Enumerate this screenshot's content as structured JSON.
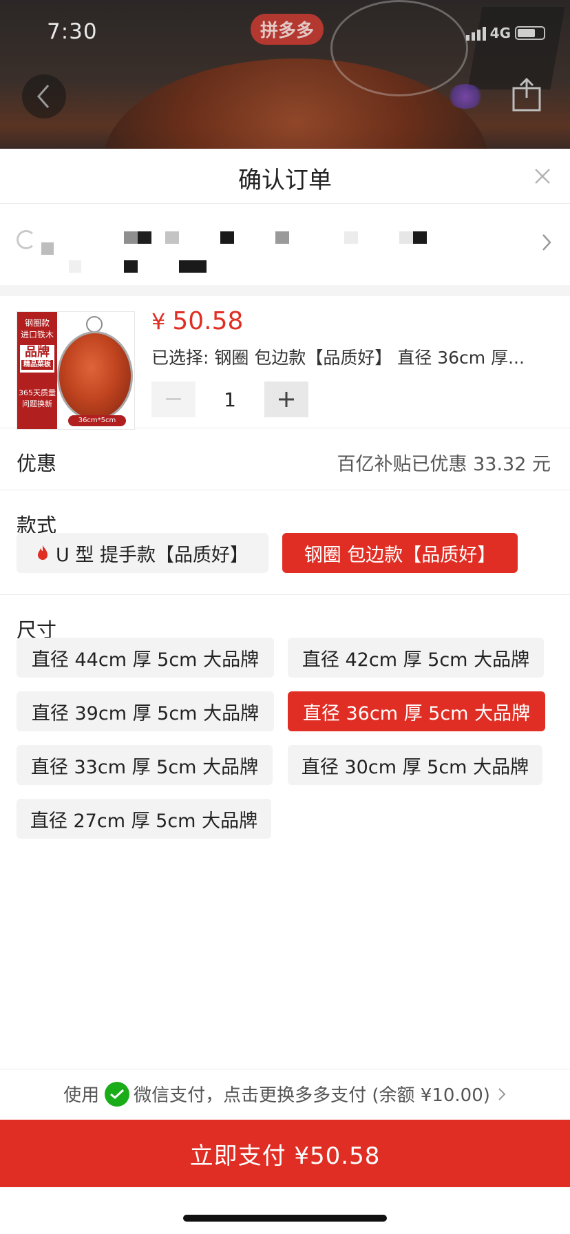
{
  "status_bar": {
    "time": "7:30",
    "network": "4G"
  },
  "backdrop": {
    "badge": "拼多多"
  },
  "sheet": {
    "title": "确认订单"
  },
  "product": {
    "currency": "¥",
    "price": "50.58",
    "selected_text": "已选择: 钢圈 包边款【品质好】 直径 36cm 厚...",
    "quantity": "1",
    "thumbnail": {
      "top_text": "钢圈款\n进口铁木",
      "brand": "品牌",
      "brand_sub": "精品菜板",
      "bottom_text": "365天质量\n问题换新",
      "dimension": "36cm*5cm"
    }
  },
  "discount": {
    "label": "优惠",
    "value": "百亿补贴已优惠 33.32 元"
  },
  "style": {
    "title": "款式",
    "options": [
      {
        "label": "U 型 提手款【品质好】",
        "active": false,
        "hot": true
      },
      {
        "label": "钢圈 包边款【品质好】",
        "active": true,
        "hot": false
      }
    ]
  },
  "size": {
    "title": "尺寸",
    "options": [
      {
        "label": "直径 44cm 厚 5cm 大品牌",
        "active": false
      },
      {
        "label": "直径 42cm 厚 5cm 大品牌",
        "active": false
      },
      {
        "label": "直径 39cm 厚 5cm 大品牌",
        "active": false
      },
      {
        "label": "直径 36cm 厚 5cm 大品牌",
        "active": true
      },
      {
        "label": "直径 33cm 厚 5cm 大品牌",
        "active": false
      },
      {
        "label": "直径 30cm 厚 5cm 大品牌",
        "active": false
      },
      {
        "label": "直径 27cm 厚 5cm 大品牌",
        "active": false
      }
    ]
  },
  "payment": {
    "prefix": "使用",
    "method_text": "微信支付，点击更换多多支付 (余额 ¥10.00)",
    "button_label": "立即支付 ¥50.58"
  },
  "colors": {
    "accent": "#e02e24",
    "wechat": "#1aad19"
  },
  "icons": [
    "back-arrow-icon",
    "share-icon",
    "close-icon",
    "location-icon",
    "chevron-right-icon",
    "minus-icon",
    "plus-icon",
    "flame-icon",
    "wechat-pay-icon"
  ]
}
